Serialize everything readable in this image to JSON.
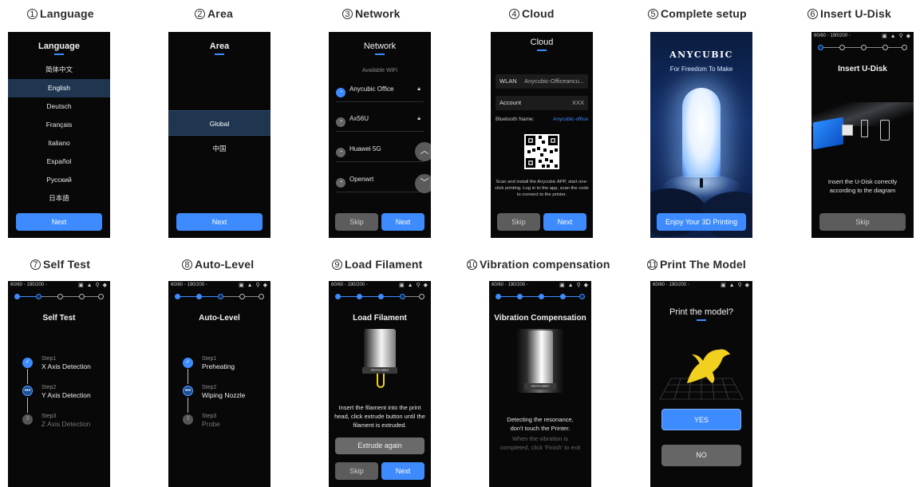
{
  "labels": [
    {
      "num": "1",
      "text": "Language"
    },
    {
      "num": "2",
      "text": "Area"
    },
    {
      "num": "3",
      "text": "Network"
    },
    {
      "num": "4",
      "text": "Cloud"
    },
    {
      "num": "5",
      "text": "Complete setup"
    },
    {
      "num": "6",
      "text": "Insert U-Disk"
    },
    {
      "num": "7",
      "text": "Self Test"
    },
    {
      "num": "8",
      "text": "Auto-Level"
    },
    {
      "num": "9",
      "text": "Load Filament"
    },
    {
      "num": "10",
      "text": "Vibration compensation"
    },
    {
      "num": "11",
      "text": "Print The Model"
    }
  ],
  "status_bar": {
    "left": "60/60 ◦  190/200 ◦",
    "right": "▣ ▲ ⚲ ◆"
  },
  "language": {
    "title": "Language",
    "items": [
      "简体中文",
      "English",
      "Deutsch",
      "Français",
      "Italiano",
      "Español",
      "Русский",
      "日本語"
    ],
    "selected": "English",
    "next": "Next"
  },
  "area": {
    "title": "Area",
    "items": [
      "Global",
      "中国"
    ],
    "next": "Next"
  },
  "network": {
    "title": "Network",
    "subtitle": "Available WiFi",
    "networks": [
      "Anycubic Office",
      "Ax56U",
      "Huawei 5G",
      "Openwrt"
    ],
    "skip": "Skip",
    "next": "Next"
  },
  "cloud": {
    "title": "Cloud",
    "wlan_label": "WLAN",
    "wlan_value": "Anycubic-Officeancu...",
    "account_label": "Account",
    "account_value": "XXX",
    "bt_label": "Bluetooth Name:",
    "bt_value": "Anycubic-office",
    "note": "Scan and install the Anycubic APP, start one-click printing. Log in to the app, scan the code to connect to the printer.",
    "skip": "Skip",
    "next": "Next"
  },
  "complete": {
    "brand": "ANYCUBIC",
    "tagline": "For Freedom To Make",
    "button": "Enjoy Your 3D Printing"
  },
  "udisk": {
    "title": "Insert U-Disk",
    "text": "Insert the U-Disk correctly according to the diagram",
    "skip": "Skip"
  },
  "selftest": {
    "title": "Self Test",
    "steps": [
      {
        "k": "Step1",
        "t": "X Axis Detection",
        "badge": "✓"
      },
      {
        "k": "Step2",
        "t": "Y Axis Detection",
        "badge": "•••"
      },
      {
        "k": "Step3",
        "t": "Z Axis Detection",
        "badge": "3"
      }
    ]
  },
  "autolevel": {
    "title": "Auto-Level",
    "steps": [
      {
        "k": "Step1",
        "t": "Preheating",
        "badge": "✓"
      },
      {
        "k": "Step2",
        "t": "Wiping Nozzle",
        "badge": "•••"
      },
      {
        "k": "Step3",
        "t": "Probe",
        "badge": "3"
      }
    ]
  },
  "filament": {
    "title": "Load Filament",
    "head_brand": "ANYCUBIC",
    "text": "Insert the filament into the print head, click extrude button until the filament is extruded.",
    "extrude": "Extrude again",
    "skip": "Skip",
    "next": "Next"
  },
  "vibration": {
    "title": "Vibration Compensation",
    "head_brand": "ANYCUBIC",
    "text": "Detecting the resonance, don't touch the Printer.",
    "hint": "When the vibration is completed, click 'Finish' to exit"
  },
  "printmodel": {
    "title": "Print the model?",
    "yes": "YES",
    "no": "NO"
  },
  "colors": {
    "accent": "#3d8bff",
    "screen": "#080808",
    "gray_button": "#5c5c5c",
    "selection": "#1f3550",
    "model": "#f2d020"
  }
}
